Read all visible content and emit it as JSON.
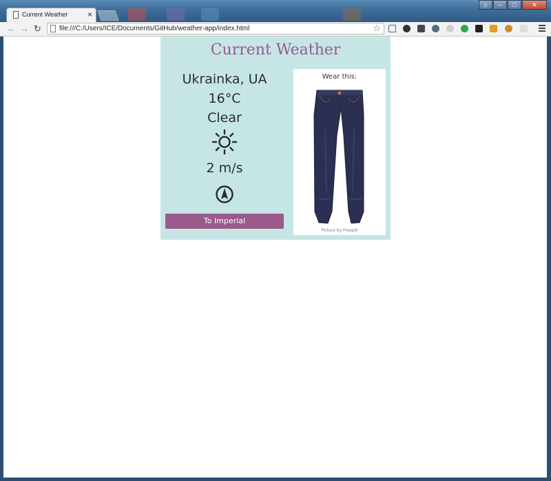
{
  "browser": {
    "tab_title": "Current Weather",
    "tab_close": "×",
    "url": "file:///C:/Users/ICE/Documents/GitHub/weather-app/index.html",
    "back_glyph": "←",
    "forward_glyph": "→",
    "reload_glyph": "↻",
    "star_glyph": "☆"
  },
  "window_buttons": {
    "user": "⌂",
    "minimize": "–",
    "maximize": "□",
    "close": "✕"
  },
  "weather": {
    "title": "Current Weather",
    "location": "Ukrainka, UA",
    "temperature": "16°C",
    "condition": "Clear",
    "condition_icon": "sun-icon",
    "wind_speed": "2 m/s",
    "wind_direction_icon": "compass-arrow-icon",
    "unit_toggle_label": "To Imperial",
    "wear_label": "Wear this:",
    "clothing_item": "jeans",
    "credit": "Picture by Freepik"
  },
  "colors": {
    "card_bg": "#c6e6e6",
    "accent": "#9a5a8c",
    "text": "#2b2b2b",
    "jeans": "#2b2f52"
  }
}
